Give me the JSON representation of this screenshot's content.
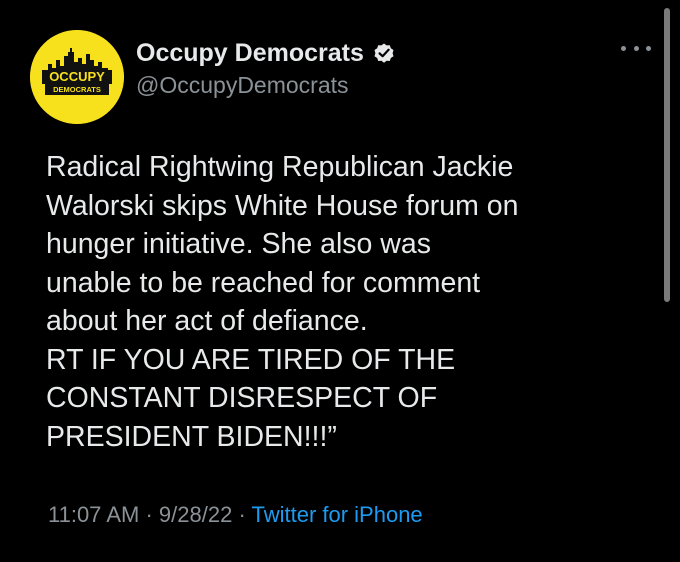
{
  "account": {
    "display_name": "Occupy Democrats",
    "handle": "@OccupyDemocrats",
    "avatar_text_top": "OCCUPY",
    "avatar_text_bottom": "DEMOCRATS",
    "verified": true,
    "verified_icon": "verified-badge-icon",
    "avatar_bg": "#f7e01c"
  },
  "menu": {
    "icon": "more-options-icon"
  },
  "tweet": {
    "lines": [
      "Radical Rightwing Republican Jackie",
      "Walorski skips White House forum on",
      "hunger initiative. She also was",
      "unable to be reached for comment",
      "about her act of defiance.",
      "RT IF YOU ARE TIRED OF THE",
      "CONSTANT DISRESPECT OF",
      "PRESIDENT BIDEN!!!”"
    ],
    "time": "11:07 AM",
    "date": "9/28/22",
    "separator": "·",
    "source": "Twitter for iPhone"
  },
  "colors": {
    "background": "#000000",
    "text": "#e7e9ea",
    "secondary": "#8b9297",
    "link": "#1d9bf0"
  }
}
